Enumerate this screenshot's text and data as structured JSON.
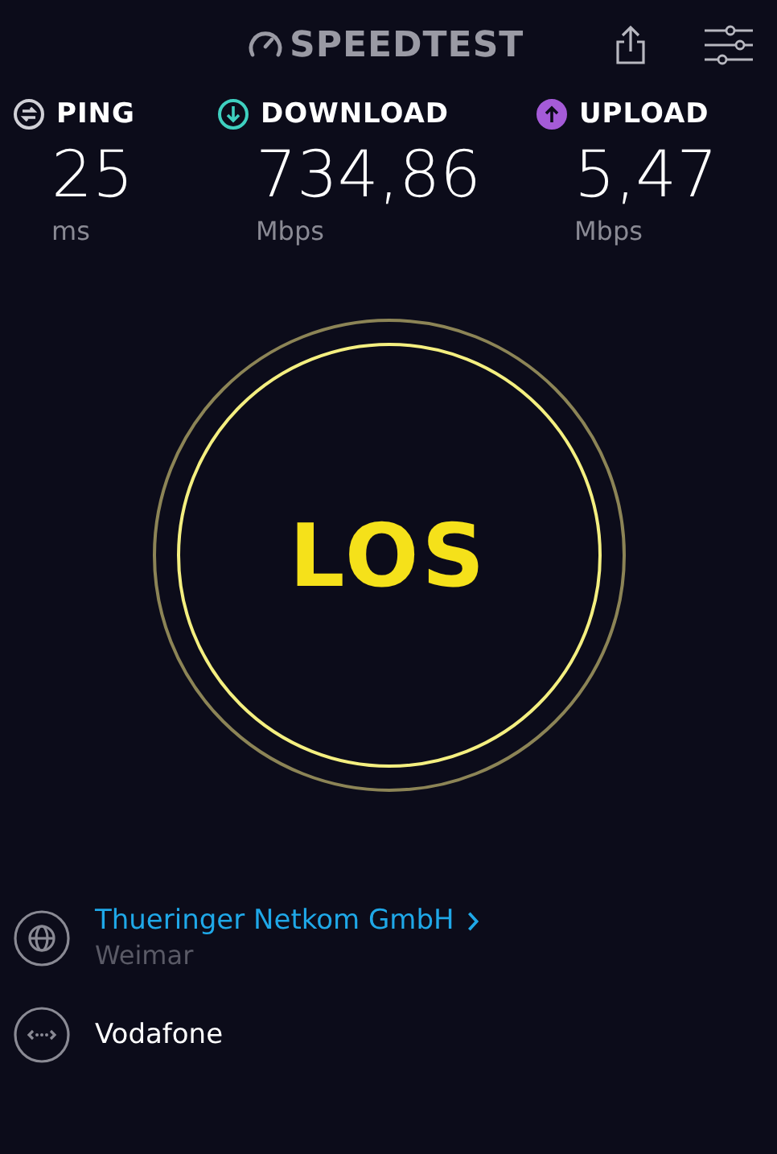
{
  "header": {
    "logo": "SPEEDTEST"
  },
  "metrics": [
    {
      "kind": "ping",
      "label": "PING",
      "value": "25",
      "unit": "ms",
      "color": "#d0d0d6"
    },
    {
      "kind": "download",
      "label": "DOWNLOAD",
      "value": "734,86",
      "unit": "Mbps",
      "color": "#3fd0c0"
    },
    {
      "kind": "upload",
      "label": "UPLOAD",
      "value": "5,47",
      "unit": "Mbps",
      "color": "#a55bd8"
    }
  ],
  "go_button": {
    "label": "LOS"
  },
  "server": {
    "name": "Thueringer Netkom GmbH",
    "location": "Weimar"
  },
  "provider": {
    "name": "Vodafone"
  }
}
